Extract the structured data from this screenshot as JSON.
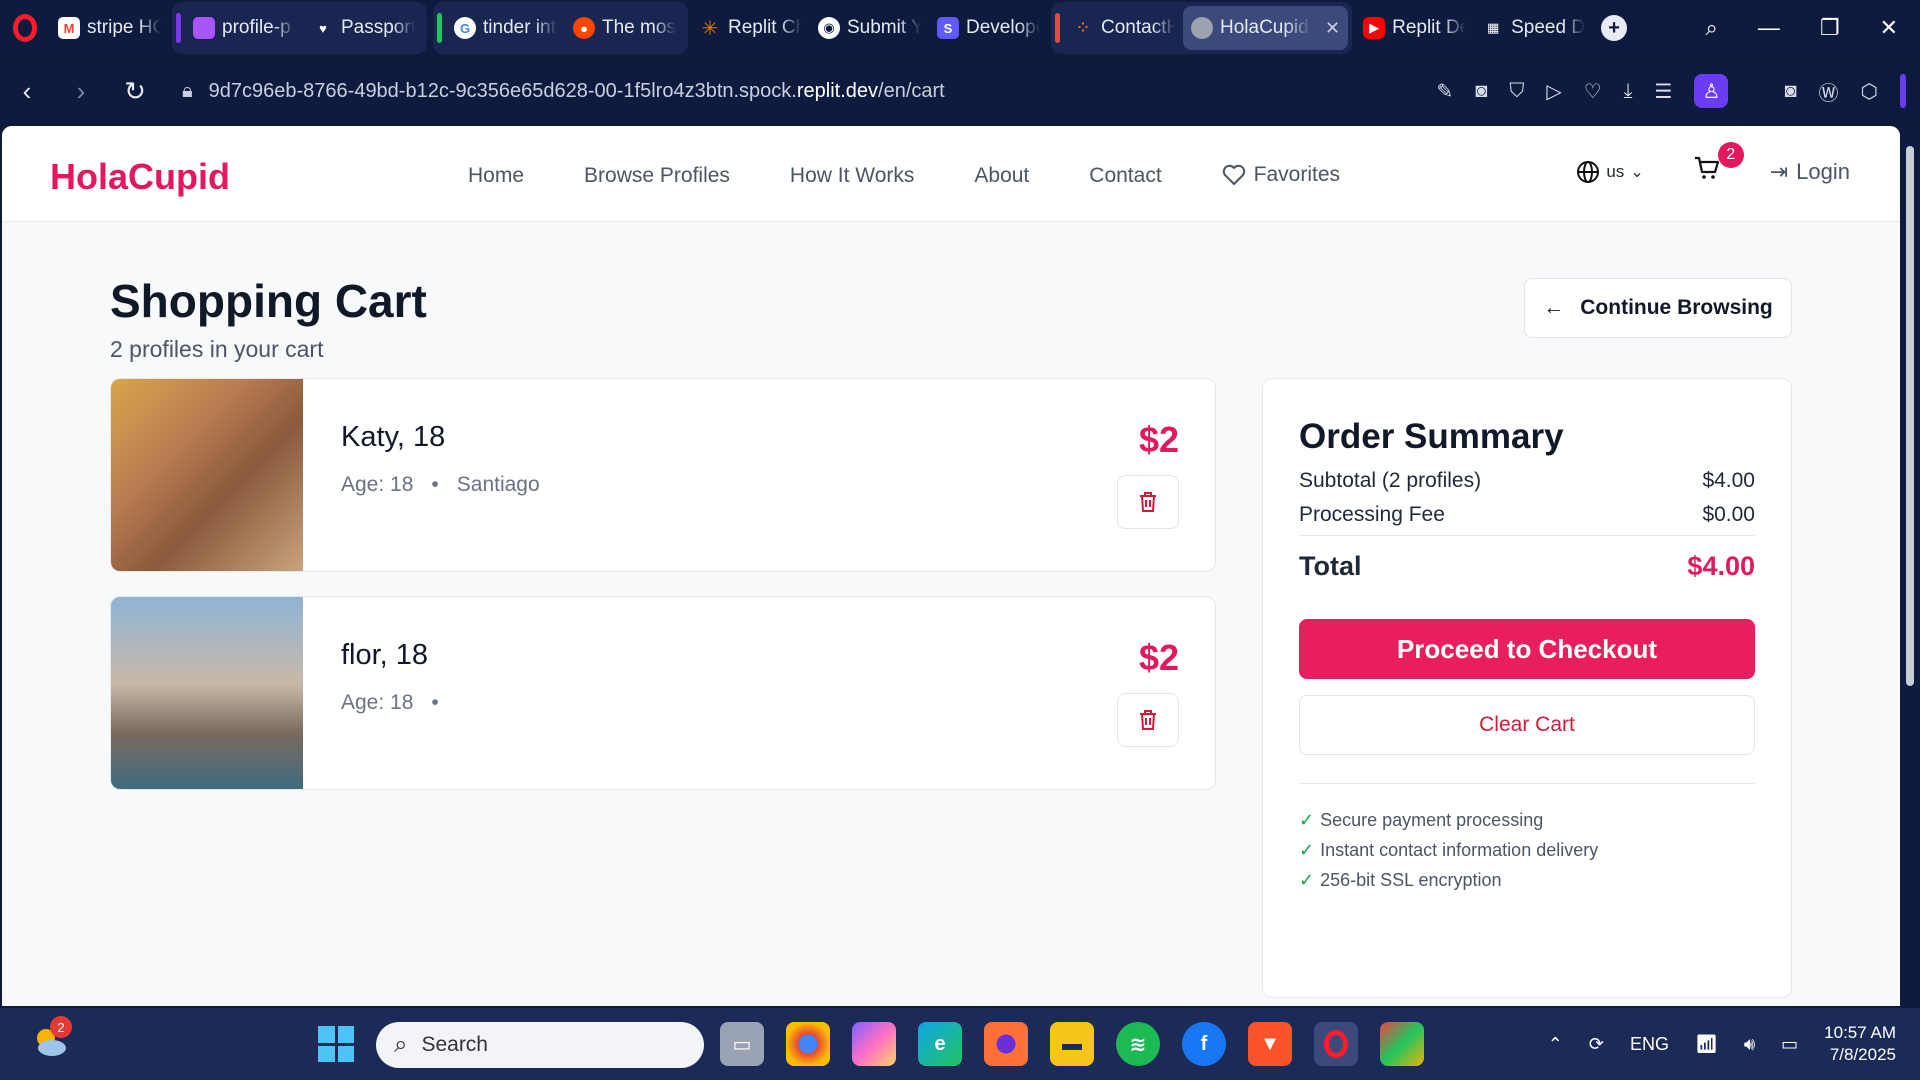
{
  "browser": {
    "tabs": [
      {
        "label": "stripe HC",
        "fav_color": "#ea4335",
        "fav_text": "M"
      },
      {
        "label": "profile-p",
        "fav_color": "#a855f7",
        "fav_text": ""
      },
      {
        "label": "Passport",
        "fav_color": "#ffffff",
        "fav_text": ""
      },
      {
        "label": "tinder int",
        "fav_color": "#ffffff",
        "fav_text": "G"
      },
      {
        "label": "The most",
        "fav_color": "#ff4500",
        "fav_text": ""
      },
      {
        "label": "Replit Ch",
        "fav_color": "#d97706",
        "fav_text": ""
      },
      {
        "label": "Submit Y",
        "fav_color": "#ffffff",
        "fav_text": ""
      },
      {
        "label": "Develope",
        "fav_color": "#635bff",
        "fav_text": "S"
      },
      {
        "label": "ContactH",
        "fav_color": "#f97316",
        "fav_text": ""
      },
      {
        "label": "HolaCupid -",
        "fav_color": "#9ca3af",
        "fav_text": ""
      },
      {
        "label": "Replit De",
        "fav_color": "#ff0000",
        "fav_text": "▶"
      },
      {
        "label": "Speed Di",
        "fav_color": "#1f2b55",
        "fav_text": "▦"
      }
    ],
    "url_prefix": "9d7c96eb-8766-49bd-b12c-9c356e65d628-00-1f5lro4z3btn.spock.",
    "url_host": "replit.dev",
    "url_path": "/en/cart"
  },
  "site": {
    "logo": "HolaCupid",
    "nav": [
      "Home",
      "Browse Profiles",
      "How It Works",
      "About",
      "Contact"
    ],
    "favorites": "Favorites",
    "lang": "us",
    "cart_count": "2",
    "login": "Login"
  },
  "cart": {
    "title": "Shopping Cart",
    "subtitle": "2 profiles in your cart",
    "continue": "Continue Browsing",
    "items": [
      {
        "name": "Katy, 18",
        "age": "Age: 18",
        "location": "Santiago",
        "price": "$2"
      },
      {
        "name": "flor, 18",
        "age": "Age: 18",
        "location": "",
        "price": "$2"
      }
    ]
  },
  "summary": {
    "title": "Order Summary",
    "subtotal_label": "Subtotal (2 profiles)",
    "subtotal": "$4.00",
    "fee_label": "Processing Fee",
    "fee": "$0.00",
    "total_label": "Total",
    "total": "$4.00",
    "checkout": "Proceed to Checkout",
    "clear": "Clear Cart",
    "features": [
      "Secure payment processing",
      "Instant contact information delivery",
      "256-bit SSL encryption"
    ]
  },
  "taskbar": {
    "weather_badge": "2",
    "search": "Search",
    "lang": "ENG",
    "time": "10:57 AM",
    "date": "7/8/2025"
  },
  "colors": {
    "brand": "#e3185d",
    "checkout": "#e91e5c"
  }
}
